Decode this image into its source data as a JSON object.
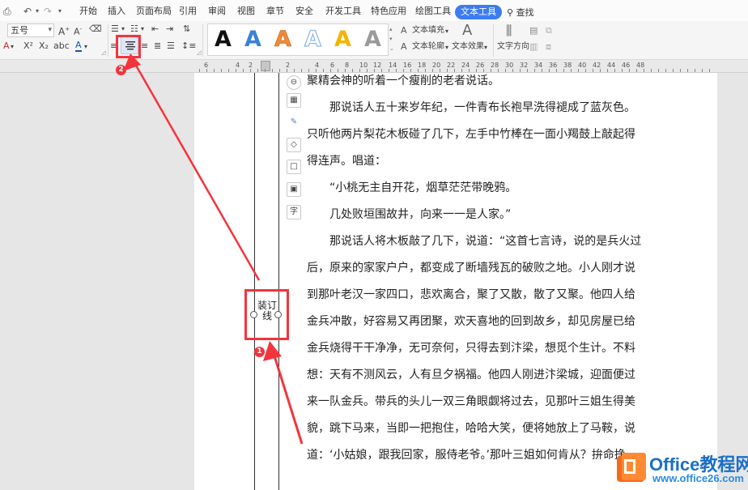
{
  "menubar": {
    "tabs": [
      "开始",
      "插入",
      "页面布局",
      "引用",
      "审阅",
      "视图",
      "章节",
      "安全",
      "开发工具",
      "特色应用",
      "绘图工具",
      "文本工具"
    ],
    "active_tab": "文本工具",
    "search_label": "查找"
  },
  "ribbon": {
    "font_size": "五号",
    "text_fill_label": "文本填充",
    "text_outline_label": "文本轮廓",
    "text_effect_label": "文本效果",
    "text_direction_label": "文字方向",
    "wordart_glyph": "A",
    "wordart_colors": [
      "#111111",
      "#3b82d6",
      "#f08a3a",
      "#8fb7e8",
      "#f5b400",
      "#9a9a9a"
    ]
  },
  "ruler": {
    "numbers": [
      "6",
      "4",
      "2",
      "2",
      "4",
      "6",
      "8",
      "10",
      "12",
      "14",
      "16",
      "18",
      "20",
      "22",
      "24",
      "26",
      "28",
      "30",
      "32",
      "34",
      "36",
      "38",
      "40",
      "42",
      "44",
      "46",
      "48"
    ]
  },
  "document": {
    "lines": [
      "聚精会神的听着一个瘦削的老者说话。",
      "　　那说话人五十来岁年纪，一件青布长袍早洗得褪成了蓝灰色。",
      "只听他两片梨花木板碰了几下，左手中竹棒在一面小羯鼓上敲起得",
      "得连声。唱道：",
      "　　“小桃无主自开花，烟草茫茫带晚鸦。",
      "　　几处败垣围故井，向来一一是人家。”",
      "　　那说话人将木板敲了几下，说道：“这首七言诗，说的是兵火过",
      "后，原来的家家户户，都变成了断墙残瓦的破败之地。小人刚才说",
      "到那叶老汉一家四口，悲欢离合，聚了又散，散了又聚。他四人给",
      "金兵冲散，好容易又再团聚，欢天喜地的回到故乡，却见房屋已给",
      "金兵烧得干干净净，无可奈何，只得去到汴梁，想觅个生计。不料",
      "想：天有不测风云，人有旦夕祸福。他四人刚进汴梁城，迎面便过",
      "来一队金兵。带兵的头儿一双三角眼觑将过去，见那叶三姐生得美",
      "貌，跳下马来，当即一把抱住，哈哈大笑，便将她放上了马鞍，说",
      "道：‘小姑娘，跟我回家，服侍老爷。’那叶三姐如何肯从？拚命挣"
    ],
    "gutter_text": "装订线"
  },
  "annotations": {
    "badge_1": "1",
    "badge_2": "2",
    "highlight_color": "#f3343d"
  },
  "watermark": {
    "brand": "Office教程网",
    "url": "www.office26.com"
  }
}
